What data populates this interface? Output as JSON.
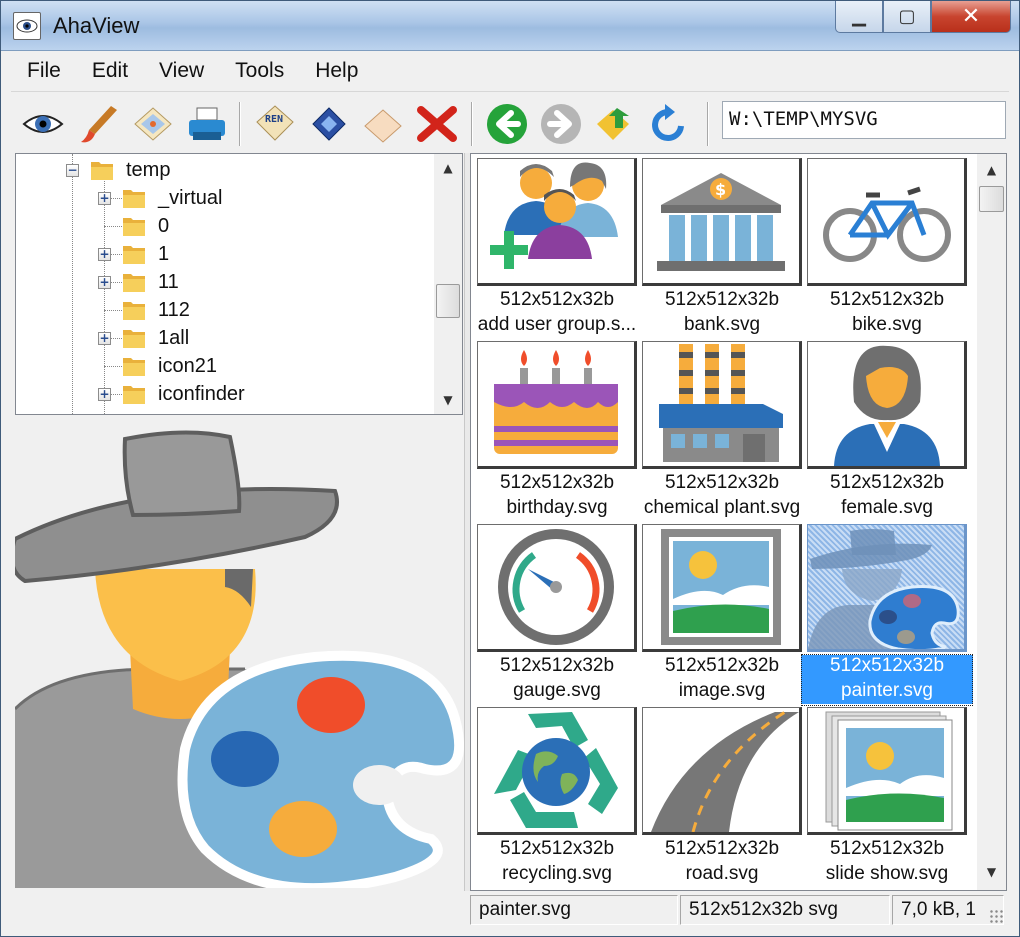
{
  "window": {
    "title": "AhaView"
  },
  "menu": [
    "File",
    "Edit",
    "View",
    "Tools",
    "Help"
  ],
  "toolbar": {
    "path": "W:\\TEMP\\MYSVG",
    "icons": [
      "view-eye-icon",
      "paint-brush-icon",
      "slideshow-icon",
      "printer-icon",
      "rename-icon",
      "film-icon",
      "erase-icon",
      "delete-x-icon",
      "back-arrow-icon",
      "forward-arrow-icon",
      "up-folder-icon",
      "refresh-icon"
    ]
  },
  "tree": {
    "root": "temp",
    "children": [
      {
        "label": "_virtual",
        "expandable": true
      },
      {
        "label": "0",
        "expandable": false
      },
      {
        "label": "1",
        "expandable": true
      },
      {
        "label": "11",
        "expandable": true
      },
      {
        "label": "112",
        "expandable": false
      },
      {
        "label": "1all",
        "expandable": true
      },
      {
        "label": "icon21",
        "expandable": false
      },
      {
        "label": "iconfinder",
        "expandable": true
      }
    ]
  },
  "thumbnails": [
    {
      "name": "add user group.s...",
      "dims": "512x512x32b",
      "icon": "add-user-group-icon"
    },
    {
      "name": "bank.svg",
      "dims": "512x512x32b",
      "icon": "bank-icon"
    },
    {
      "name": "bike.svg",
      "dims": "512x512x32b",
      "icon": "bike-icon"
    },
    {
      "name": "birthday.svg",
      "dims": "512x512x32b",
      "icon": "birthday-cake-icon"
    },
    {
      "name": "chemical plant.svg",
      "dims": "512x512x32b",
      "icon": "chemical-plant-icon"
    },
    {
      "name": "female.svg",
      "dims": "512x512x32b",
      "icon": "female-icon"
    },
    {
      "name": "gauge.svg",
      "dims": "512x512x32b",
      "icon": "gauge-icon"
    },
    {
      "name": "image.svg",
      "dims": "512x512x32b",
      "icon": "image-icon"
    },
    {
      "name": "painter.svg",
      "dims": "512x512x32b",
      "icon": "painter-icon",
      "selected": true
    },
    {
      "name": "recycling.svg",
      "dims": "512x512x32b",
      "icon": "recycling-icon"
    },
    {
      "name": "road.svg",
      "dims": "512x512x32b",
      "icon": "road-icon"
    },
    {
      "name": "slide show.svg",
      "dims": "512x512x32b",
      "icon": "slide-show-icon"
    }
  ],
  "status": {
    "file": "painter.svg",
    "info": "512x512x32b svg",
    "size": "7,0 kB, 1"
  },
  "colors": {
    "selection": "#3399ff",
    "preview_bg": "#f0f0f0"
  }
}
